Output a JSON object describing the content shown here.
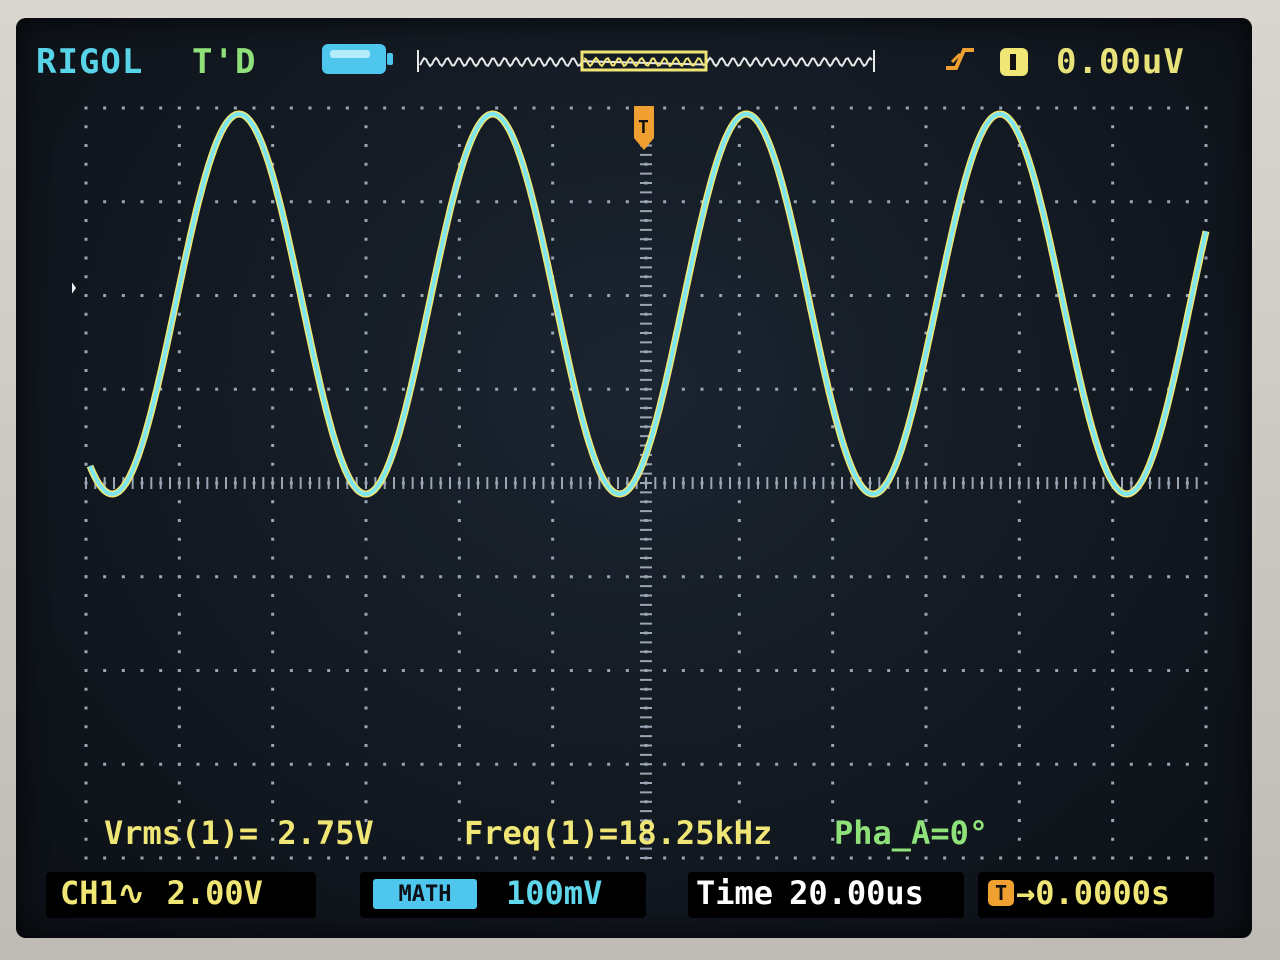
{
  "header": {
    "brand": "RIGOL",
    "trigger_status": "T'D",
    "trigger_level": "0.00uV",
    "trigger_marker": "T"
  },
  "waveform": {
    "channel": "CH1",
    "color": "#7ee6f0",
    "edge_color": "#f0e676",
    "cycles_visible": 4.4,
    "shape": "sine"
  },
  "measurements": {
    "vrms": "Vrms(1)= 2.75V",
    "freq": "Freq(1)=18.25kHz",
    "phase": "Pha_A=0°"
  },
  "footer": {
    "ch1_label": "CH1∿",
    "ch1_scale": "2.00V",
    "coupling_icon": "MATH",
    "math_scale": "100mV",
    "time_label": "Time",
    "time_scale": "20.00us",
    "trig_pos_icon": "T",
    "trig_pos": "→0.0000s"
  },
  "icons": {
    "battery": "battery-icon",
    "trigger_edge": "rising-edge-icon",
    "ch1_ground": "ground-marker-icon",
    "trigger_position": "trigger-position-icon"
  },
  "colors": {
    "grid": "#9aa6b4",
    "trace": "#7ee6f0",
    "yellow_text": "#f0e676",
    "green_text": "#8fe27a"
  }
}
